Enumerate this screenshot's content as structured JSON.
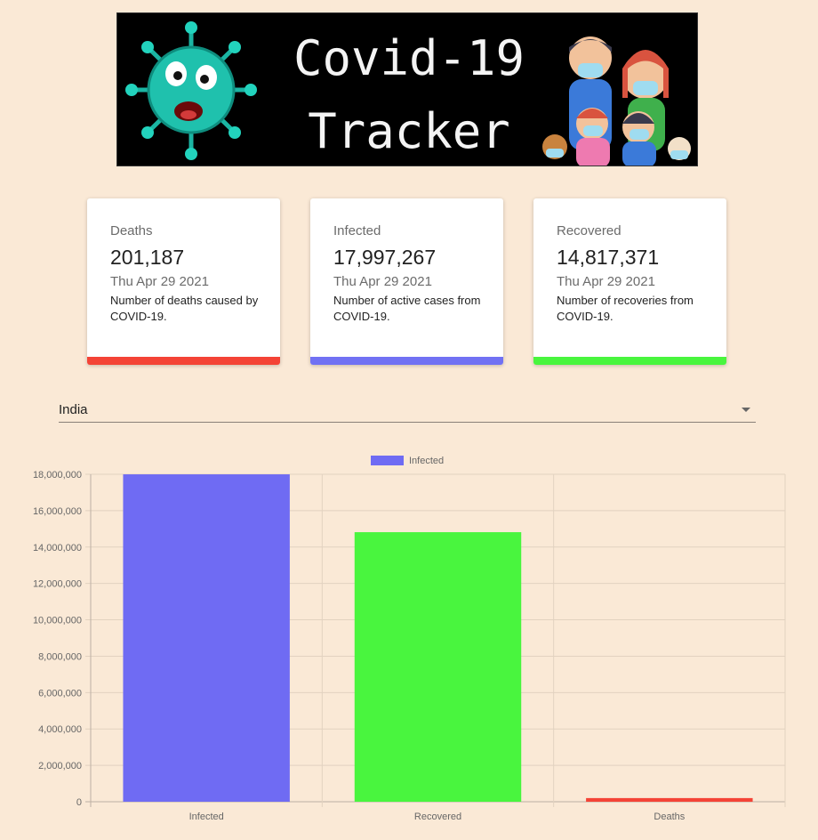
{
  "banner": {
    "line1": "Covid-19",
    "line2": "Tracker"
  },
  "cards": [
    {
      "label": "Deaths",
      "value": "201,187",
      "date": "Thu Apr 29 2021",
      "desc": "Number of deaths caused by COVID-19.",
      "color": "#f44336"
    },
    {
      "label": "Infected",
      "value": "17,997,267",
      "date": "Thu Apr 29 2021",
      "desc": "Number of active cases from COVID-19.",
      "color": "#7171f3"
    },
    {
      "label": "Recovered",
      "value": "14,817,371",
      "date": "Thu Apr 29 2021",
      "desc": "Number of recoveries from COVID-19.",
      "color": "#49f53e"
    }
  ],
  "country_select": {
    "value": "India"
  },
  "chart_data": {
    "type": "bar",
    "legend": {
      "label": "Infected",
      "position": "top",
      "color": "#6f6bf3"
    },
    "categories": [
      "Infected",
      "Recovered",
      "Deaths"
    ],
    "values": [
      17997267,
      14817371,
      201187
    ],
    "colors": [
      "#6f6bf3",
      "#49f53e",
      "#f44336"
    ],
    "ylim": [
      0,
      18000000
    ],
    "yticks": [
      0,
      2000000,
      4000000,
      6000000,
      8000000,
      10000000,
      12000000,
      14000000,
      16000000,
      18000000
    ],
    "ytick_labels": [
      "0",
      "2,000,000",
      "4,000,000",
      "6,000,000",
      "8,000,000",
      "10,000,000",
      "12,000,000",
      "14,000,000",
      "16,000,000",
      "18,000,000"
    ],
    "grid": true
  }
}
